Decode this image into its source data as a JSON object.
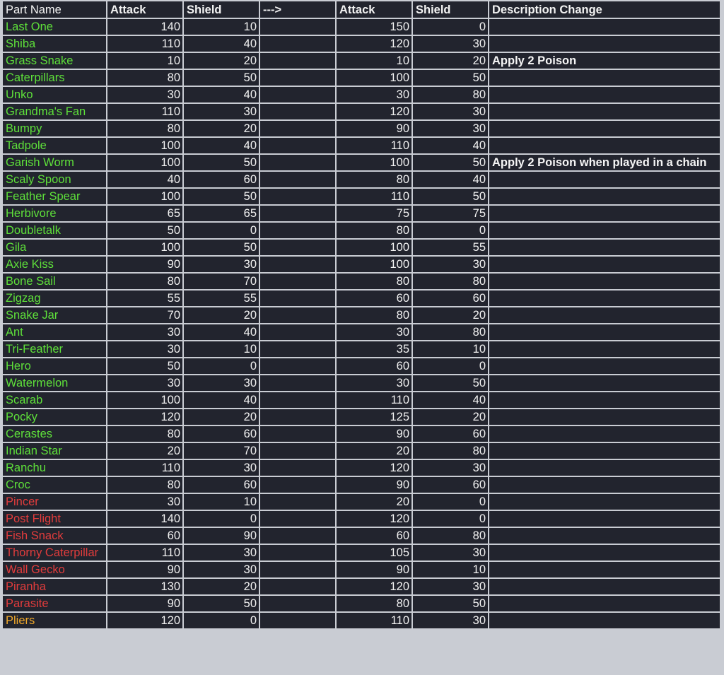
{
  "colors": {
    "green": "#5ee03a",
    "red": "#e23c3c",
    "orange": "#f0a82a",
    "text": "#f2f2f2",
    "background": "#22242e",
    "grid": "#c9ccd3"
  },
  "headers": {
    "part_name": "Part Name",
    "attack_old": "Attack",
    "shield_old": "Shield",
    "arrow": "--->",
    "attack_new": "Attack",
    "shield_new": "Shield",
    "description": "Description Change"
  },
  "rows": [
    {
      "name": "Last One",
      "color": "green",
      "attack_old": "140",
      "shield_old": "10",
      "attack_new": "150",
      "shield_new": "0",
      "description": ""
    },
    {
      "name": "Shiba",
      "color": "green",
      "attack_old": "110",
      "shield_old": "40",
      "attack_new": "120",
      "shield_new": "30",
      "description": ""
    },
    {
      "name": "Grass Snake",
      "color": "green",
      "attack_old": "10",
      "shield_old": "20",
      "attack_new": "10",
      "shield_new": "20",
      "description": "Apply 2 Poison"
    },
    {
      "name": "Caterpillars",
      "color": "green",
      "attack_old": "80",
      "shield_old": "50",
      "attack_new": "100",
      "shield_new": "50",
      "description": ""
    },
    {
      "name": "Unko",
      "color": "green",
      "attack_old": "30",
      "shield_old": "40",
      "attack_new": "30",
      "shield_new": "80",
      "description": ""
    },
    {
      "name": "Grandma's Fan",
      "color": "green",
      "attack_old": "110",
      "shield_old": "30",
      "attack_new": "120",
      "shield_new": "30",
      "description": ""
    },
    {
      "name": "Bumpy",
      "color": "green",
      "attack_old": "80",
      "shield_old": "20",
      "attack_new": "90",
      "shield_new": "30",
      "description": ""
    },
    {
      "name": "Tadpole",
      "color": "green",
      "attack_old": "100",
      "shield_old": "40",
      "attack_new": "110",
      "shield_new": "40",
      "description": ""
    },
    {
      "name": "Garish Worm",
      "color": "green",
      "attack_old": "100",
      "shield_old": "50",
      "attack_new": "100",
      "shield_new": "50",
      "description": "Apply 2 Poison when played in a chain"
    },
    {
      "name": "Scaly Spoon",
      "color": "green",
      "attack_old": "40",
      "shield_old": "60",
      "attack_new": "80",
      "shield_new": "40",
      "description": ""
    },
    {
      "name": "Feather Spear",
      "color": "green",
      "attack_old": "100",
      "shield_old": "50",
      "attack_new": "110",
      "shield_new": "50",
      "description": ""
    },
    {
      "name": "Herbivore",
      "color": "green",
      "attack_old": "65",
      "shield_old": "65",
      "attack_new": "75",
      "shield_new": "75",
      "description": ""
    },
    {
      "name": "Doubletalk",
      "color": "green",
      "attack_old": "50",
      "shield_old": "0",
      "attack_new": "80",
      "shield_new": "0",
      "description": ""
    },
    {
      "name": "Gila",
      "color": "green",
      "attack_old": "100",
      "shield_old": "50",
      "attack_new": "100",
      "shield_new": "55",
      "description": ""
    },
    {
      "name": "Axie Kiss",
      "color": "green",
      "attack_old": "90",
      "shield_old": "30",
      "attack_new": "100",
      "shield_new": "30",
      "description": ""
    },
    {
      "name": "Bone Sail",
      "color": "green",
      "attack_old": "80",
      "shield_old": "70",
      "attack_new": "80",
      "shield_new": "80",
      "description": ""
    },
    {
      "name": "Zigzag",
      "color": "green",
      "attack_old": "55",
      "shield_old": "55",
      "attack_new": "60",
      "shield_new": "60",
      "description": ""
    },
    {
      "name": "Snake Jar",
      "color": "green",
      "attack_old": "70",
      "shield_old": "20",
      "attack_new": "80",
      "shield_new": "20",
      "description": ""
    },
    {
      "name": "Ant",
      "color": "green",
      "attack_old": "30",
      "shield_old": "40",
      "attack_new": "30",
      "shield_new": "80",
      "description": ""
    },
    {
      "name": "Tri-Feather",
      "color": "green",
      "attack_old": "30",
      "shield_old": "10",
      "attack_new": "35",
      "shield_new": "10",
      "description": ""
    },
    {
      "name": "Hero",
      "color": "green",
      "attack_old": "50",
      "shield_old": "0",
      "attack_new": "60",
      "shield_new": "0",
      "description": ""
    },
    {
      "name": "Watermelon",
      "color": "green",
      "attack_old": "30",
      "shield_old": "30",
      "attack_new": "30",
      "shield_new": "50",
      "description": ""
    },
    {
      "name": "Scarab",
      "color": "green",
      "attack_old": "100",
      "shield_old": "40",
      "attack_new": "110",
      "shield_new": "40",
      "description": ""
    },
    {
      "name": "Pocky",
      "color": "green",
      "attack_old": "120",
      "shield_old": "20",
      "attack_new": "125",
      "shield_new": "20",
      "description": ""
    },
    {
      "name": "Cerastes",
      "color": "green",
      "attack_old": "80",
      "shield_old": "60",
      "attack_new": "90",
      "shield_new": "60",
      "description": ""
    },
    {
      "name": "Indian Star",
      "color": "green",
      "attack_old": "20",
      "shield_old": "70",
      "attack_new": "20",
      "shield_new": "80",
      "description": ""
    },
    {
      "name": "Ranchu",
      "color": "green",
      "attack_old": "110",
      "shield_old": "30",
      "attack_new": "120",
      "shield_new": "30",
      "description": ""
    },
    {
      "name": "Croc",
      "color": "green",
      "attack_old": "80",
      "shield_old": "60",
      "attack_new": "90",
      "shield_new": "60",
      "description": ""
    },
    {
      "name": "Pincer",
      "color": "red",
      "attack_old": "30",
      "shield_old": "10",
      "attack_new": "20",
      "shield_new": "0",
      "description": ""
    },
    {
      "name": "Post Flight",
      "color": "red",
      "attack_old": "140",
      "shield_old": "0",
      "attack_new": "120",
      "shield_new": "0",
      "description": ""
    },
    {
      "name": "Fish Snack",
      "color": "red",
      "attack_old": "60",
      "shield_old": "90",
      "attack_new": "60",
      "shield_new": "80",
      "description": ""
    },
    {
      "name": "Thorny Caterpillar",
      "color": "red",
      "attack_old": "110",
      "shield_old": "30",
      "attack_new": "105",
      "shield_new": "30",
      "description": ""
    },
    {
      "name": "Wall Gecko",
      "color": "red",
      "attack_old": "90",
      "shield_old": "30",
      "attack_new": "90",
      "shield_new": "10",
      "description": ""
    },
    {
      "name": "Piranha",
      "color": "red",
      "attack_old": "130",
      "shield_old": "20",
      "attack_new": "120",
      "shield_new": "30",
      "description": ""
    },
    {
      "name": "Parasite",
      "color": "red",
      "attack_old": "90",
      "shield_old": "50",
      "attack_new": "80",
      "shield_new": "50",
      "description": ""
    },
    {
      "name": "Pliers",
      "color": "orange",
      "attack_old": "120",
      "shield_old": "0",
      "attack_new": "110",
      "shield_new": "30",
      "description": ""
    }
  ]
}
